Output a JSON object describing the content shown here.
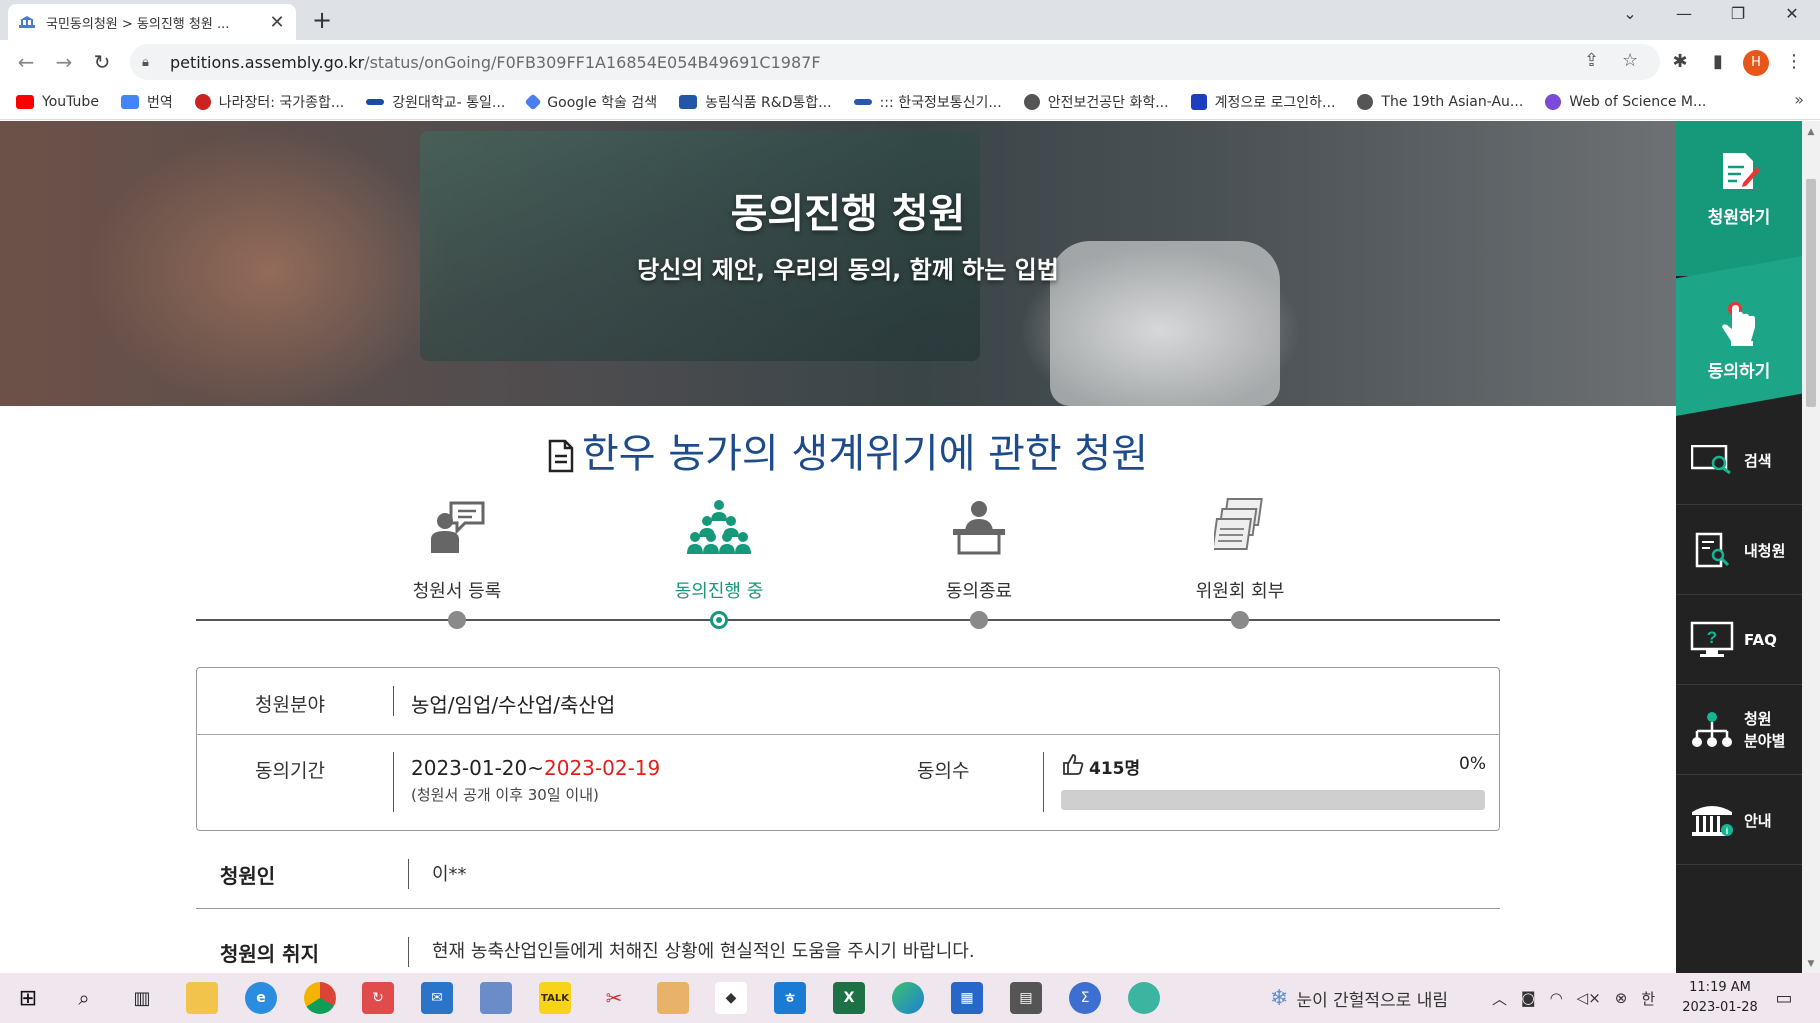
{
  "browser": {
    "tab_title": "국민동의청원 > 동의진행 청원 ...",
    "tab_close": "✕",
    "new_tab": "+",
    "url_host": "petitions.assembly.go.kr",
    "url_path": "/status/onGoing/F0FB309FF1A16854E054B49691C1987F",
    "profile_initial": "H",
    "bookmarks": [
      "YouTube",
      "번역",
      "나라장터: 국가종합...",
      "강원대학교- 통일...",
      "Google 학술 검색",
      "농림식품 R&D통합...",
      "::: 한국정보통신기...",
      "안전보건공단 화학...",
      "계정으로 로그인하...",
      "The 19th Asian-Au...",
      "Web of Science M..."
    ],
    "bookmarks_more": "»"
  },
  "hero": {
    "title": "동의진행 청원",
    "subtitle": "당신의 제안, 우리의 동의, 함께 하는 입법"
  },
  "petition": {
    "title": "한우 농가의 생계위기에 관한 청원",
    "steps": [
      {
        "label": "청원서 등록",
        "icon": "registration-icon"
      },
      {
        "label": "동의진행 중",
        "icon": "people-group-icon"
      },
      {
        "label": "동의종료",
        "icon": "podium-icon"
      },
      {
        "label": "위원회 회부",
        "icon": "documents-stack-icon"
      }
    ],
    "field_label": "청원분야",
    "field_value": "농업/임업/수산업/축산업",
    "period_label": "동의기간",
    "period_start": "2023-01-20~",
    "period_end": "2023-02-19",
    "period_note": "(청원서 공개 이후 30일 이내)",
    "agree_label": "동의수",
    "agree_count": "415명",
    "agree_percent": "0%",
    "agree_fraction": 0,
    "petitioner_label": "청원인",
    "petitioner_value": "이**",
    "purpose_label": "청원의 취지",
    "purpose_value": "현재 농축산업인들에게 처해진 상황에 현실적인 도움을 주시기 바랍니다."
  },
  "sidebar": {
    "petition_btn": "청원하기",
    "agree_btn": "동의하기",
    "items": [
      "검색",
      "내청원",
      "FAQ",
      "청원\n분야별",
      "안내"
    ]
  },
  "taskbar": {
    "weather": "눈이 간헐적으로 내림",
    "ime": "한",
    "time": "11:19 AM",
    "date": "2023-01-28"
  },
  "colors": {
    "accent": "#16987a",
    "title_blue": "#1d4b8c",
    "deadline_red": "#e0201c"
  }
}
